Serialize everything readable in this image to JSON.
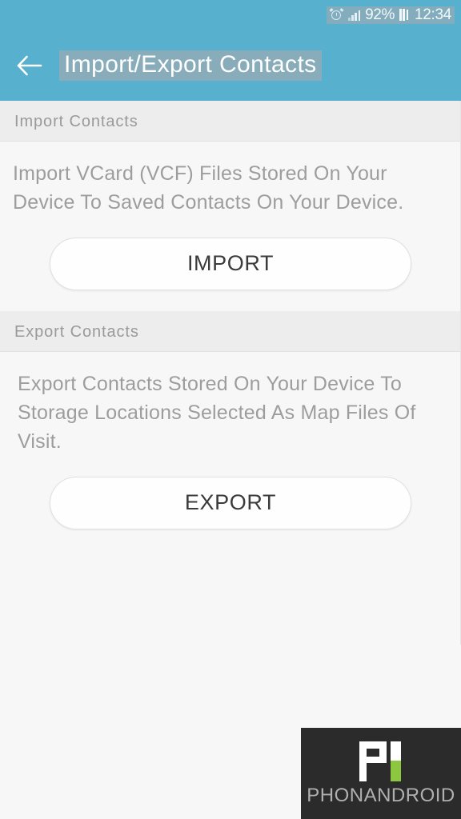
{
  "theme": {
    "accent": "#56b0ce",
    "section_header_bg": "#ededed",
    "body_bg": "#f7f7f7",
    "button_bg": "#fefefe",
    "muted_text": "#9d9d9d",
    "watermark_bg": "#2b2b2b",
    "watermark_green": "#8dc63f"
  },
  "status_bar": {
    "alarm_icon": "alarm-clock-icon",
    "signal_icon": "signal-bars-icon",
    "battery_percent": "92%",
    "battery_icon": "battery-icon",
    "time": "12:34"
  },
  "app_bar": {
    "back_icon": "back-arrow-icon",
    "title": "Import/Export Contacts"
  },
  "sections": [
    {
      "id": "import",
      "header": "Import Contacts",
      "description": "Import VCard (VCF) Files Stored On Your Device To Saved Contacts On Your Device.",
      "button_label": "IMPORT"
    },
    {
      "id": "export",
      "header": "Export Contacts",
      "description": "Export Contacts Stored On Your Device To Storage Locations Selected As Map Files Of Visit.",
      "button_label": "EXPORT"
    }
  ],
  "watermark": {
    "brand": "PHONANDROID",
    "logo_icon": "phonandroid-logo-icon"
  }
}
